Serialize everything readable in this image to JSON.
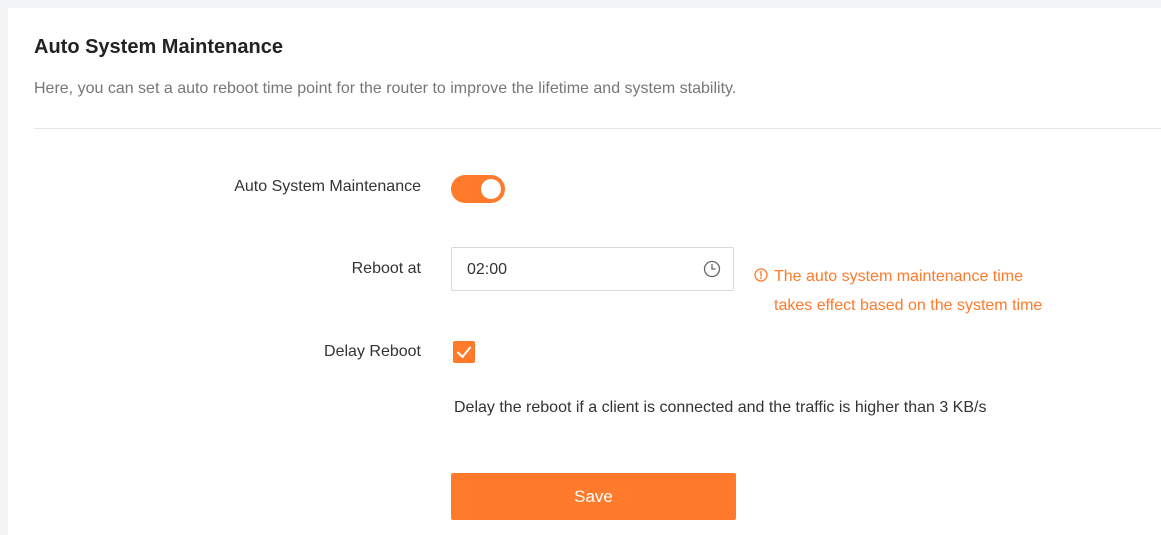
{
  "header": {
    "title": "Auto System Maintenance",
    "description": "Here, you can set a auto reboot time point for the router to improve the lifetime and system stability."
  },
  "form": {
    "auto_maintenance": {
      "label": "Auto System Maintenance",
      "enabled": true
    },
    "reboot_at": {
      "label": "Reboot at",
      "value": "02:00",
      "icon": "clock-icon",
      "hint_line1": "The auto system maintenance time",
      "hint_line2": "takes effect based on the system time",
      "hint_icon": "warning-circle-icon"
    },
    "delay_reboot": {
      "label": "Delay Reboot",
      "checked": true,
      "note": "Delay the reboot if a client is connected and the traffic is higher than 3 KB/s"
    },
    "save_label": "Save"
  },
  "colors": {
    "accent": "#ff7a2a",
    "text": "#333333",
    "muted": "#777777"
  }
}
